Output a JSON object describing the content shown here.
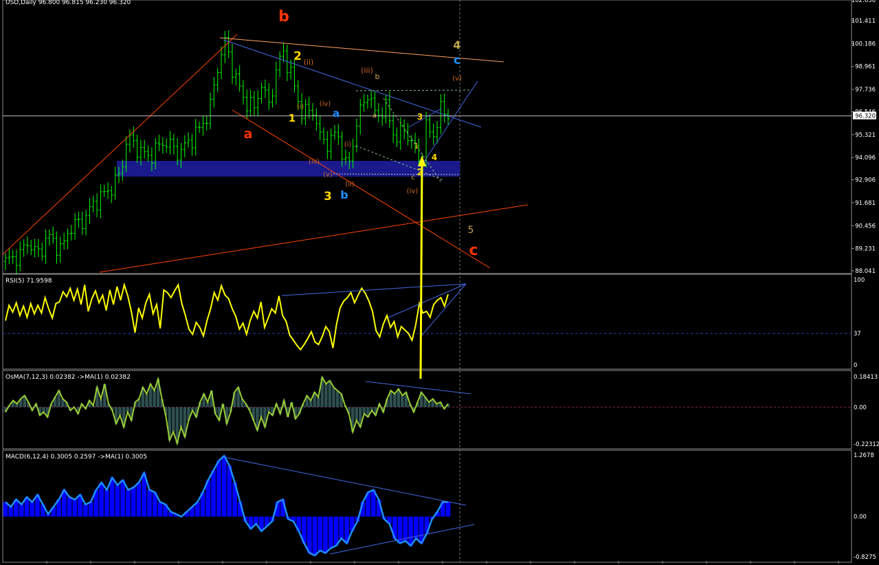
{
  "chart_data": [
    {
      "type": "candlestick",
      "title": "USD,Daily  96.800 96.815 96.230 96.320",
      "last_price": "96.320",
      "ylim": [
        88.041,
        102.636
      ],
      "y_ticks": [
        "101.411",
        "100.186",
        "98.961",
        "97.736",
        "96.546",
        "95.321",
        "94.096",
        "92.906",
        "91.681",
        "90.456",
        "89.231",
        "88.041"
      ],
      "top_partial_tick": "102.636",
      "colors": {
        "candle": "#00ff00",
        "zone": "#1a1a8c",
        "channel_red": "#ff4500",
        "channel_blue": "#4169e1",
        "last_line": "#c0c0c0"
      },
      "wave_labels": [
        {
          "text": "b",
          "color": "#ff3300"
        },
        {
          "text": "2",
          "color": "#ffd700"
        },
        {
          "text": "(ii)",
          "color": "#d2691e"
        },
        {
          "text": "(iii)",
          "color": "#d2691e"
        },
        {
          "text": "b",
          "color": "#ccaa55"
        },
        {
          "text": "4",
          "color": "#bfa64a"
        },
        {
          "text": "c",
          "color": "#1e90ff"
        },
        {
          "text": "(v)",
          "color": "#d2691e"
        },
        {
          "text": "(i)",
          "color": "#d2691e"
        },
        {
          "text": "(iv)",
          "color": "#d2691e"
        },
        {
          "text": "a",
          "color": "#1e90ff"
        },
        {
          "text": "1",
          "color": "#ffd700"
        },
        {
          "text": "a",
          "color": "#ff3300"
        },
        {
          "text": "a",
          "color": "#ccaa55"
        },
        {
          "text": "3",
          "color": "#ffd700"
        },
        {
          "text": "(i)",
          "color": "#d2691e"
        },
        {
          "text": "(iii)",
          "color": "#d2691e"
        },
        {
          "text": "1",
          "color": "#ffd700"
        },
        {
          "text": "2",
          "color": "#ffd700"
        },
        {
          "text": "4",
          "color": "#ffd700"
        },
        {
          "text": "c",
          "color": "#ccaa55"
        },
        {
          "text": "(v)",
          "color": "#d2691e"
        },
        {
          "text": "(ii)",
          "color": "#d2691e"
        },
        {
          "text": "(iv)",
          "color": "#d2691e"
        },
        {
          "text": "3",
          "color": "#ffd700"
        },
        {
          "text": "b",
          "color": "#1e90ff"
        },
        {
          "text": "5",
          "color": "#bfa64a"
        },
        {
          "text": "c",
          "color": "#ff3300"
        }
      ]
    },
    {
      "type": "line",
      "title": "RSI(5) 71.9598",
      "ylim": [
        0,
        100
      ],
      "y_ticks": [
        "100",
        "37",
        "0"
      ],
      "level": 37,
      "series": [
        {
          "name": "RSI(5)",
          "color": "#ffff00",
          "values": [
            52,
            70,
            62,
            73,
            58,
            69,
            56,
            72,
            60,
            70,
            61,
            79,
            66,
            55,
            72,
            74,
            86,
            80,
            90,
            76,
            89,
            71,
            94,
            63,
            78,
            87,
            73,
            82,
            64,
            88,
            71,
            92,
            76,
            94,
            81,
            62,
            38,
            67,
            55,
            73,
            83,
            60,
            71,
            43,
            88,
            85,
            79,
            87,
            94,
            72,
            58,
            42,
            36,
            50,
            44,
            34,
            52,
            66,
            85,
            76,
            93,
            82,
            78,
            66,
            57,
            42,
            49,
            36,
            52,
            63,
            55,
            74,
            44,
            55,
            66,
            61,
            81,
            58,
            51,
            35,
            29,
            23,
            18,
            24,
            31,
            39,
            27,
            24,
            33,
            45,
            39,
            20,
            48,
            67,
            75,
            79,
            85,
            73,
            82,
            90,
            84,
            75,
            63,
            40,
            33,
            48,
            58,
            44,
            51,
            33,
            45,
            41,
            37,
            29,
            47,
            72,
            61,
            63,
            56,
            71,
            76,
            79,
            69,
            83
          ]
        }
      ]
    },
    {
      "type": "bar",
      "title": "OsMA(7,12,3) 0.02382  ->MA(1) 0.02382",
      "ylim": [
        -0.22312,
        0.18413
      ],
      "y_ticks": [
        "0.18413",
        "0.00",
        "-0.22312"
      ],
      "series": [
        {
          "name": "OsMA(7,12,3)",
          "color": "#2f4f4f",
          "values": [
            -0.03,
            0.01,
            0.04,
            0.02,
            0.05,
            0.07,
            0.03,
            -0.02,
            0.02,
            -0.05,
            -0.03,
            -0.06,
            0.02,
            0.06,
            0.1,
            0.05,
            0.03,
            -0.02,
            0.0,
            -0.04,
            0.02,
            -0.01,
            0.04,
            0.01,
            0.12,
            0.05,
            0.14,
            0.02,
            -0.02,
            -0.1,
            -0.05,
            -0.12,
            -0.03,
            -0.08,
            0.03,
            0.05,
            0.12,
            0.08,
            0.14,
            0.1,
            0.17,
            0.05,
            -0.05,
            -0.2,
            -0.15,
            -0.22,
            -0.12,
            -0.18,
            -0.08,
            -0.02,
            -0.06,
            0.03,
            0.08,
            0.03,
            0.1,
            -0.04,
            -0.08,
            0.02,
            -0.1,
            -0.03,
            0.09,
            0.12,
            0.05,
            0.02,
            -0.02,
            -0.08,
            -0.14,
            -0.06,
            -0.12,
            -0.03,
            -0.05,
            0.02,
            -0.04,
            0.04,
            -0.06,
            0.03,
            -0.07,
            -0.04,
            0.02,
            0.07,
            0.04,
            0.09,
            0.06,
            0.18,
            0.14,
            0.16,
            0.12,
            0.1,
            0.08,
            0.01,
            -0.04,
            -0.15,
            -0.08,
            -0.12,
            -0.04,
            -0.06,
            -0.02,
            -0.05,
            0.02,
            -0.03,
            0.05,
            0.1,
            0.08,
            0.11,
            0.07,
            0.09,
            0.02,
            -0.03,
            0.03,
            0.09,
            0.06,
            0.03,
            0.05,
            0.02,
            0.03,
            -0.01,
            0.02
          ]
        }
      ]
    },
    {
      "type": "area",
      "title": "MACD(6,12,4) 0.3005 0.2597  ->MA(1) 0.3005",
      "ylim": [
        -0.8275,
        1.2678
      ],
      "y_ticks": [
        "1.2678",
        "0.00",
        "-0.8275"
      ],
      "series": [
        {
          "name": "MACD(6,12,4)",
          "color": "#0000ff",
          "values": [
            0.3,
            0.2,
            0.35,
            0.25,
            0.4,
            0.3,
            0.45,
            0.25,
            0.05,
            0.2,
            0.35,
            0.55,
            0.4,
            0.35,
            0.45,
            0.25,
            0.3,
            0.55,
            0.7,
            0.55,
            0.8,
            0.65,
            0.75,
            0.55,
            0.6,
            0.7,
            0.9,
            0.55,
            0.5,
            0.3,
            0.25,
            0.1,
            0.05,
            0.0,
            0.1,
            0.2,
            0.3,
            0.5,
            0.75,
            0.95,
            1.15,
            1.25,
            1.05,
            0.7,
            0.3,
            -0.1,
            -0.25,
            -0.15,
            -0.3,
            -0.2,
            -0.1,
            0.3,
            0.35,
            -0.05,
            -0.1,
            -0.3,
            -0.55,
            -0.75,
            -0.8,
            -0.7,
            -0.75,
            -0.65,
            -0.6,
            -0.45,
            -0.55,
            -0.3,
            -0.1,
            0.3,
            0.5,
            0.55,
            0.35,
            -0.05,
            -0.15,
            -0.45,
            -0.55,
            -0.5,
            -0.6,
            -0.45,
            -0.55,
            -0.35,
            -0.05,
            0.1,
            0.3,
            0.3
          ]
        }
      ]
    }
  ]
}
